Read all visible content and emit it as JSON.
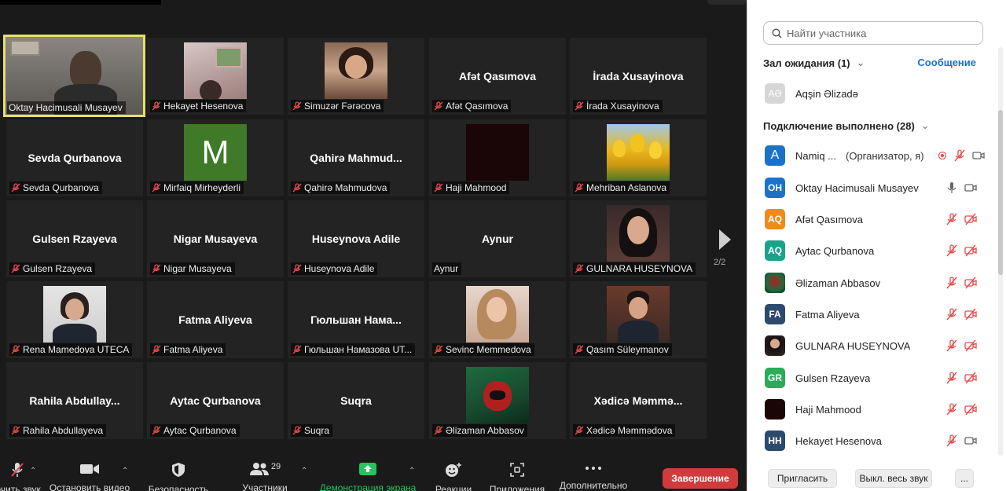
{
  "video": {
    "active_speaker": "Oktay Hacimusali Musayev",
    "page_indicator": "2/2",
    "tiles": [
      {
        "display": "",
        "label": "Oktay Hacimusali Musayev"
      },
      {
        "display": "",
        "label": "Hekayet Hesenova"
      },
      {
        "display": "",
        "label": "Simuzər Fərəcova"
      },
      {
        "display": "Afət Qasımova",
        "label": "Afət Qasımova"
      },
      {
        "display": "İrada Xusayinova",
        "label": "İrada Xusayinova"
      },
      {
        "display": "Sevda Qurbanova",
        "label": "Sevda Qurbanova"
      },
      {
        "display": "M",
        "label": "Mirfaiq Mirheyderli"
      },
      {
        "display": "Qahirə  Mahmud...",
        "label": "Qahirə Mahmudova"
      },
      {
        "display": "",
        "label": "Haji Mahmood"
      },
      {
        "display": "",
        "label": "Mehriban Aslanova"
      },
      {
        "display": "Gulsen Rzayeva",
        "label": "Gulsen Rzayeva"
      },
      {
        "display": "Nigar Musayeva",
        "label": "Nigar Musayeva"
      },
      {
        "display": "Huseynova Adile",
        "label": "Huseynova Adile"
      },
      {
        "display": "Aynur",
        "label": "Aynur"
      },
      {
        "display": "",
        "label": "GULNARA HUSEYNOVA"
      },
      {
        "display": "",
        "label": "Rena Mamedova UTECA"
      },
      {
        "display": "Fatma Aliyeva",
        "label": "Fatma Aliyeva"
      },
      {
        "display": "Гюльшан  Нама...",
        "label": "Гюльшан Намазова UT..."
      },
      {
        "display": "",
        "label": "Sevinc Memmedova"
      },
      {
        "display": "",
        "label": "Qasım Süleymanov"
      },
      {
        "display": "Rahila  Abdullay...",
        "label": "Rahila Abdullayeva"
      },
      {
        "display": "Aytac Qurbanova",
        "label": "Aytac Qurbanova"
      },
      {
        "display": "Suqra",
        "label": "Suqra"
      },
      {
        "display": "",
        "label": "Əlizaman Abbasov"
      },
      {
        "display": "Xədicə  Məmmə...",
        "label": "Xədicə Məmmədova"
      }
    ]
  },
  "toolbar": {
    "mute_label": "ючить звук",
    "video_label": "Остановить видео",
    "security_label": "Безопасность",
    "participants_label": "Участники",
    "participants_count": "29",
    "share_label": "Демонстрация экрана",
    "reactions_label": "Реакции",
    "apps_label": "Приложения",
    "more_label": "Дополнительно",
    "end_label": "Завершение"
  },
  "panel": {
    "search_placeholder": "Найти участника",
    "waiting_title": "Зал ожидания (1)",
    "message_label": "Сообщение",
    "waiting": [
      {
        "initials": "AƏ",
        "name": "Aqşin Əlizadə"
      }
    ],
    "joined_title": "Подключение выполнено (28)",
    "participants": [
      {
        "initials": "A",
        "name": "Namiq ...",
        "role": "(Организатор, я)"
      },
      {
        "initials": "OH",
        "name": "Oktay Hacimusali Musayev",
        "role": ""
      },
      {
        "initials": "AQ",
        "name": "Afət Qasımova",
        "role": ""
      },
      {
        "initials": "AQ",
        "name": "Aytac Qurbanova",
        "role": ""
      },
      {
        "initials": "",
        "name": "Əlizaman Abbasov",
        "role": ""
      },
      {
        "initials": "FA",
        "name": "Fatma Aliyeva",
        "role": ""
      },
      {
        "initials": "",
        "name": "GULNARA HUSEYNOVA",
        "role": ""
      },
      {
        "initials": "GR",
        "name": "Gulsen Rzayeva",
        "role": ""
      },
      {
        "initials": "",
        "name": "Haji Mahmood",
        "role": ""
      },
      {
        "initials": "HH",
        "name": "Hekayet Hesenova",
        "role": ""
      }
    ],
    "invite_label": "Пригласить",
    "mute_all_label": "Выкл. весь звук",
    "more_label": "..."
  },
  "colors": {
    "active_border": "#e6e06a",
    "end_button": "#d13b3b",
    "link_blue": "#1a6ed8",
    "share_green": "#23c55e"
  }
}
